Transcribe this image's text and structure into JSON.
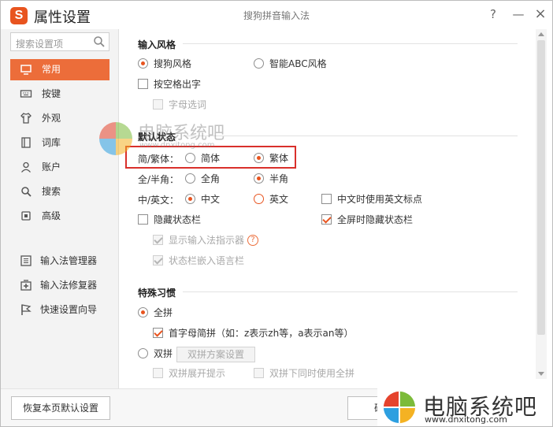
{
  "title_bar": {
    "logo_letter": "S",
    "title": "属性设置",
    "subtitle": "搜狗拼音输入法",
    "help": "?",
    "minimize": "—",
    "close": "×"
  },
  "search": {
    "placeholder": "搜索设置项",
    "icon": "search-icon"
  },
  "nav": [
    {
      "label": "常用",
      "icon": "monitor-icon",
      "active": true
    },
    {
      "label": "按键",
      "icon": "keyboard-icon"
    },
    {
      "label": "外观",
      "icon": "shirt-icon"
    },
    {
      "label": "词库",
      "icon": "book-icon"
    },
    {
      "label": "账户",
      "icon": "user-icon"
    },
    {
      "label": "搜索",
      "icon": "search-icon"
    },
    {
      "label": "高级",
      "icon": "advanced-icon"
    }
  ],
  "tools": [
    {
      "label": "输入法管理器",
      "icon": "list-icon"
    },
    {
      "label": "输入法修复器",
      "icon": "repair-icon"
    },
    {
      "label": "快速设置向导",
      "icon": "flag-icon"
    }
  ],
  "sections": {
    "input_style": {
      "title": "输入风格",
      "sogou": "搜狗风格",
      "abc": "智能ABC风格",
      "space_output": "按空格出字",
      "letter_select": "字母选词"
    },
    "default_state": {
      "title": "默认状态",
      "simp_trad_label": "简/繁体：",
      "simplified": "简体",
      "traditional": "繁体",
      "width_label": "全/半角：",
      "full_width": "全角",
      "half_width": "半角",
      "lang_label": "中/英文：",
      "chinese": "中文",
      "english": "英文",
      "english_punct": "中文时使用英文标点",
      "hide_status": "隐藏状态栏",
      "hide_fullscreen": "全屏时隐藏状态栏",
      "show_indicator": "显示输入法指示器",
      "embed_lang": "状态栏嵌入语言栏",
      "help": "?"
    },
    "special_habits": {
      "title": "特殊习惯",
      "full_pinyin": "全拼",
      "initial_pinyin": "首字母简拼（如：z表示zh等，a表示an等）",
      "double_pinyin": "双拼",
      "double_scheme_button": "双拼方案设置",
      "double_expand": "双拼展开提示",
      "double_with_full": "双拼下同时使用全拼"
    }
  },
  "footer": {
    "restore_button": "恢复本页默认设置",
    "confirm_button_partial": "确"
  },
  "watermarks": {
    "center_text": "电脑系统吧",
    "center_url": "www.dnxitong.com",
    "corner_text": "电脑系统吧",
    "corner_url": "www.dnxitong.com"
  },
  "colors": {
    "accent": "#ec6d3a",
    "highlight_border": "#d9302b"
  }
}
